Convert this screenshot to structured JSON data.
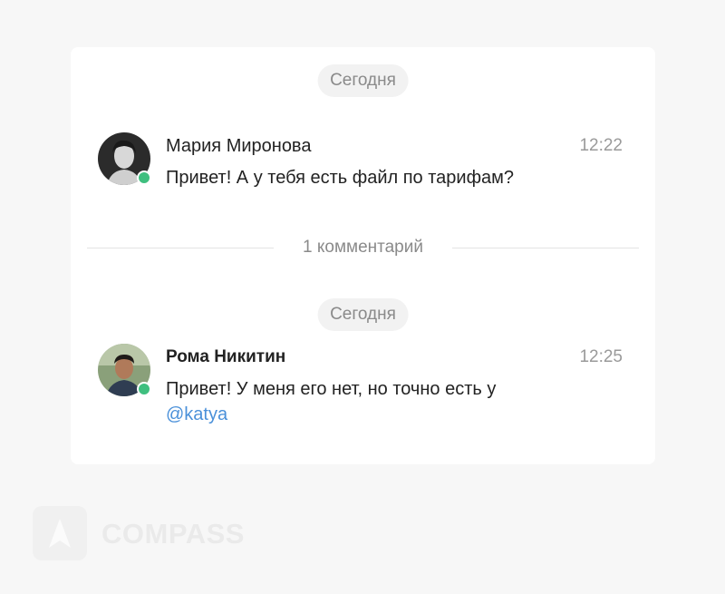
{
  "thread": {
    "day_divider_1": "Сегодня",
    "day_divider_2": "Сегодня",
    "comments_divider": "1 комментарий",
    "messages": [
      {
        "author": "Мария Миронова",
        "time": "12:22",
        "text": "Привет! А у тебя есть файл по тарифам?",
        "status": "online"
      },
      {
        "author": "Рома Никитин",
        "time": "12:25",
        "text_prefix": "Привет! У меня его нет, но точно есть у ",
        "mention": "@katya",
        "status": "online"
      }
    ]
  },
  "brand": {
    "name": "COMPASS",
    "icon": "compass-logo-icon"
  },
  "colors": {
    "background": "#f7f7f7",
    "card": "#ffffff",
    "online": "#3fbf7f",
    "mention": "#4a90d9"
  }
}
